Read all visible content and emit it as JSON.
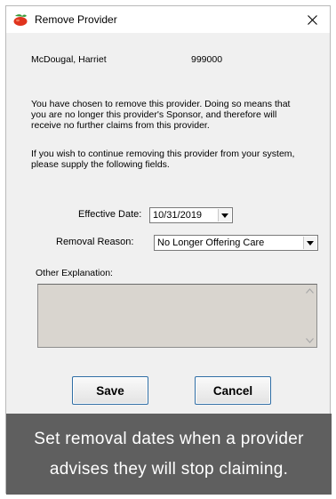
{
  "window": {
    "title": "Remove Provider",
    "close_glyph": "✕"
  },
  "provider": {
    "name": "McDougal, Harriet",
    "id": "999000"
  },
  "message": {
    "paragraph1": "You have chosen to remove this provider.  Doing so means that you are no longer this provider's Sponsor, and therefore will receive no further claims from this provider.",
    "paragraph2": "If you wish to continue removing this provider from your system, please supply the following fields."
  },
  "form": {
    "effective_date_label": "Effective Date:",
    "effective_date_value": "10/31/2019",
    "removal_reason_label": "Removal Reason:",
    "removal_reason_value": "No Longer Offering Care",
    "other_explanation_label": "Other Explanation:",
    "other_explanation_value": ""
  },
  "buttons": {
    "save_label": "Save",
    "cancel_label": "Cancel"
  },
  "caption": {
    "text": "Set removal dates when a provider advises they will stop claiming."
  },
  "icons": {
    "app": "cherry-tomato-app-icon",
    "dropdown": "triangle-down-icon",
    "scroll_up": "scroll-up-arrow-icon",
    "scroll_down": "scroll-down-arrow-icon"
  },
  "colors": {
    "button_border": "#2e6da4",
    "caption_bg": "#5f5f5f",
    "textarea_bg": "#d9d5cf"
  }
}
